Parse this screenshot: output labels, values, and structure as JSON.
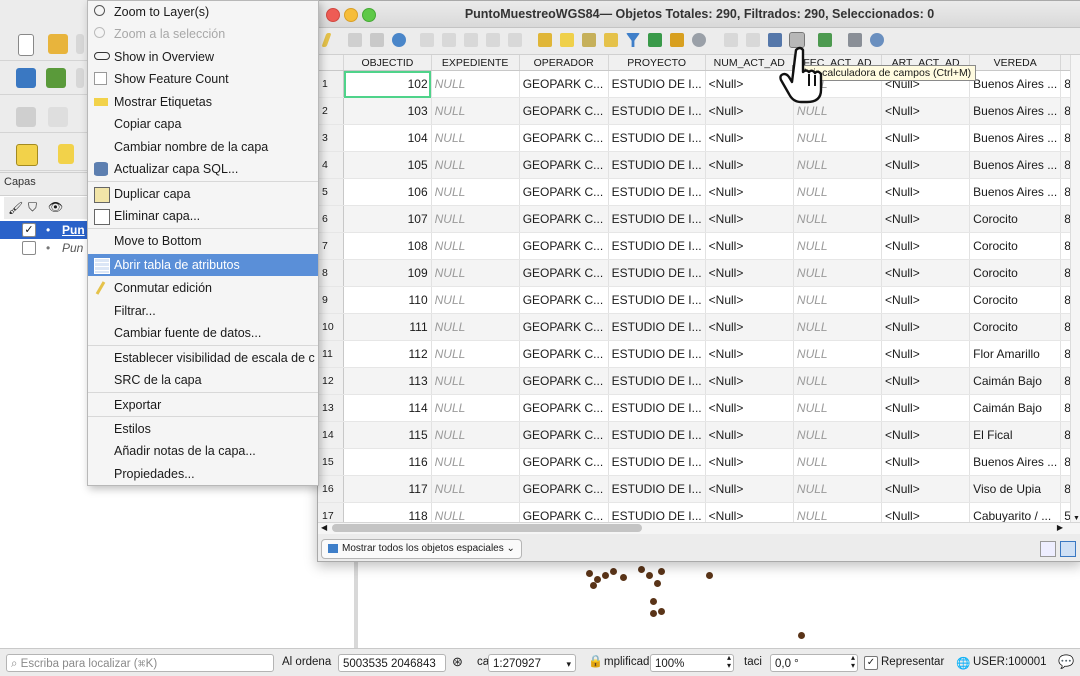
{
  "context_menu": {
    "items": [
      {
        "label": "Zoom to Layer(s)",
        "disabled": false
      },
      {
        "label": "Zoom a la selección",
        "disabled": true
      },
      {
        "label": "Show in Overview",
        "disabled": false
      },
      {
        "label": "Show Feature Count",
        "disabled": false
      },
      {
        "label": "Mostrar Etiquetas",
        "disabled": false
      },
      {
        "label": "Copiar capa",
        "disabled": false
      },
      {
        "label": "Cambiar nombre de la capa",
        "disabled": false
      },
      {
        "label": "Actualizar capa SQL...",
        "disabled": false
      },
      {
        "label": "Duplicar capa",
        "disabled": false
      },
      {
        "label": "Eliminar capa...",
        "disabled": false
      },
      {
        "label": "Move to Bottom",
        "disabled": false
      },
      {
        "label": "Abrir tabla de atributos",
        "highlighted": true
      },
      {
        "label": "Conmutar edición",
        "disabled": false
      },
      {
        "label": "Filtrar...",
        "disabled": false
      },
      {
        "label": "Cambiar fuente de datos...",
        "disabled": false
      },
      {
        "label": "Establecer visibilidad de escala de c",
        "disabled": false
      },
      {
        "label": "SRC de la capa",
        "disabled": false
      },
      {
        "label": "Exportar",
        "disabled": false
      },
      {
        "label": "Estilos",
        "disabled": false
      },
      {
        "label": "Añadir notas de la capa...",
        "disabled": false
      },
      {
        "label": "Propiedades...",
        "disabled": false
      }
    ]
  },
  "layers_panel": {
    "title": "Capas",
    "layers": [
      {
        "name": "Pun",
        "checked": true,
        "selected": true
      },
      {
        "name": "Pun",
        "checked": false,
        "selected": false
      }
    ]
  },
  "attribute_table": {
    "title": "PuntoMuestreoWGS84— Objetos Totales: 290, Filtrados: 290, Seleccionados: 0",
    "columns": [
      "OBJECTID",
      "EXPEDIENTE",
      "OPERADOR",
      "PROYECTO",
      "NUM_ACT_AD",
      "FEC_ACT_AD",
      "ART_ACT_AD",
      "VEREDA",
      "8"
    ],
    "rows": [
      {
        "n": "1",
        "objectid": "102",
        "expediente": "NULL",
        "operador": "GEOPARK C...",
        "proyecto": "ESTUDIO DE I...",
        "num": "<Null>",
        "fec": "NULL",
        "art": "<Null>",
        "vereda": "Buenos Aires ...",
        "extra": "8"
      },
      {
        "n": "2",
        "objectid": "103",
        "expediente": "NULL",
        "operador": "GEOPARK C...",
        "proyecto": "ESTUDIO DE I...",
        "num": "<Null>",
        "fec": "NULL",
        "art": "<Null>",
        "vereda": "Buenos Aires ...",
        "extra": "8"
      },
      {
        "n": "3",
        "objectid": "104",
        "expediente": "NULL",
        "operador": "GEOPARK C...",
        "proyecto": "ESTUDIO DE I...",
        "num": "<Null>",
        "fec": "NULL",
        "art": "<Null>",
        "vereda": "Buenos Aires ...",
        "extra": "8"
      },
      {
        "n": "4",
        "objectid": "105",
        "expediente": "NULL",
        "operador": "GEOPARK C...",
        "proyecto": "ESTUDIO DE I...",
        "num": "<Null>",
        "fec": "NULL",
        "art": "<Null>",
        "vereda": "Buenos Aires ...",
        "extra": "8"
      },
      {
        "n": "5",
        "objectid": "106",
        "expediente": "NULL",
        "operador": "GEOPARK C...",
        "proyecto": "ESTUDIO DE I...",
        "num": "<Null>",
        "fec": "NULL",
        "art": "<Null>",
        "vereda": "Buenos Aires ...",
        "extra": "8"
      },
      {
        "n": "6",
        "objectid": "107",
        "expediente": "NULL",
        "operador": "GEOPARK C...",
        "proyecto": "ESTUDIO DE I...",
        "num": "<Null>",
        "fec": "NULL",
        "art": "<Null>",
        "vereda": "Corocito",
        "extra": "8"
      },
      {
        "n": "7",
        "objectid": "108",
        "expediente": "NULL",
        "operador": "GEOPARK C...",
        "proyecto": "ESTUDIO DE I...",
        "num": "<Null>",
        "fec": "NULL",
        "art": "<Null>",
        "vereda": "Corocito",
        "extra": "8"
      },
      {
        "n": "8",
        "objectid": "109",
        "expediente": "NULL",
        "operador": "GEOPARK C...",
        "proyecto": "ESTUDIO DE I...",
        "num": "<Null>",
        "fec": "NULL",
        "art": "<Null>",
        "vereda": "Corocito",
        "extra": "8"
      },
      {
        "n": "9",
        "objectid": "110",
        "expediente": "NULL",
        "operador": "GEOPARK C...",
        "proyecto": "ESTUDIO DE I...",
        "num": "<Null>",
        "fec": "NULL",
        "art": "<Null>",
        "vereda": "Corocito",
        "extra": "8"
      },
      {
        "n": "10",
        "objectid": "111",
        "expediente": "NULL",
        "operador": "GEOPARK C...",
        "proyecto": "ESTUDIO DE I...",
        "num": "<Null>",
        "fec": "NULL",
        "art": "<Null>",
        "vereda": "Corocito",
        "extra": "8"
      },
      {
        "n": "11",
        "objectid": "112",
        "expediente": "NULL",
        "operador": "GEOPARK C...",
        "proyecto": "ESTUDIO DE I...",
        "num": "<Null>",
        "fec": "NULL",
        "art": "<Null>",
        "vereda": "Flor Amarillo",
        "extra": "8"
      },
      {
        "n": "12",
        "objectid": "113",
        "expediente": "NULL",
        "operador": "GEOPARK C...",
        "proyecto": "ESTUDIO DE I...",
        "num": "<Null>",
        "fec": "NULL",
        "art": "<Null>",
        "vereda": "Caimán Bajo",
        "extra": "8"
      },
      {
        "n": "13",
        "objectid": "114",
        "expediente": "NULL",
        "operador": "GEOPARK C...",
        "proyecto": "ESTUDIO DE I...",
        "num": "<Null>",
        "fec": "NULL",
        "art": "<Null>",
        "vereda": "Caimán Bajo",
        "extra": "8"
      },
      {
        "n": "14",
        "objectid": "115",
        "expediente": "NULL",
        "operador": "GEOPARK C...",
        "proyecto": "ESTUDIO DE I...",
        "num": "<Null>",
        "fec": "NULL",
        "art": "<Null>",
        "vereda": "El Fical",
        "extra": "8"
      },
      {
        "n": "15",
        "objectid": "116",
        "expediente": "NULL",
        "operador": "GEOPARK C...",
        "proyecto": "ESTUDIO DE I...",
        "num": "<Null>",
        "fec": "NULL",
        "art": "<Null>",
        "vereda": "Buenos Aires ...",
        "extra": "8"
      },
      {
        "n": "16",
        "objectid": "117",
        "expediente": "NULL",
        "operador": "GEOPARK C...",
        "proyecto": "ESTUDIO DE I...",
        "num": "<Null>",
        "fec": "NULL",
        "art": "<Null>",
        "vereda": "Viso de Upia",
        "extra": "8"
      },
      {
        "n": "17",
        "objectid": "118",
        "expediente": "NULL",
        "operador": "GEOPARK C...",
        "proyecto": "ESTUDIO DE I...",
        "num": "<Null>",
        "fec": "NULL",
        "art": "<Null>",
        "vereda": "Cabuyarito / ...",
        "extra": "5"
      }
    ],
    "tooltip": "Abrir calculadora de campos (Ctrl+M)",
    "filter_button": "Mostrar todos los objetos espaciales"
  },
  "statusbar": {
    "search_placeholder": "Escriba para localizar (⌘K)",
    "coord_label": "Al ordena",
    "coord_value": "5003535 2046843",
    "scale_label": "ca",
    "scale_value": "1:270927",
    "magnifier_label": "mplificad",
    "magnifier_value": "100%",
    "rotation_label": "taci",
    "rotation_value": "0,0 °",
    "render_label": "Representar",
    "crs_label": "USER:100001"
  },
  "colors": {
    "highlight": "#5a8fd8",
    "selection": "#2a62c9",
    "map_points": "#5a3418"
  }
}
